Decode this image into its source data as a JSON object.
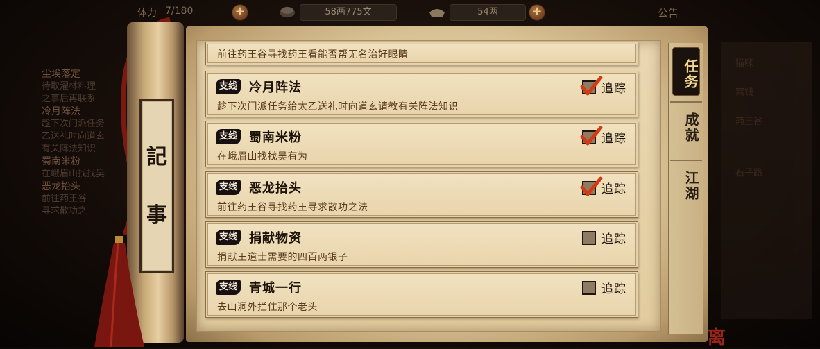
{
  "top_bar": {
    "stamina_label": "体力",
    "stamina_value": "7/180",
    "copper": "58两775文",
    "silver": "54两",
    "notice": "公告"
  },
  "background_list": [
    {
      "title": "尘埃落定",
      "lines": [
        "待取濯林料理",
        "之事后再联系"
      ]
    },
    {
      "title": "冷月阵法",
      "lines": [
        "趁下次门派任务",
        "乙送礼时向道玄",
        "有关阵法知识"
      ]
    },
    {
      "title": "蜀南米粉",
      "lines": [
        "在峨眉山找找吴"
      ]
    },
    {
      "title": "恶龙抬头",
      "lines": [
        "前往药王谷",
        "寻求散功之"
      ]
    }
  ],
  "background_right": [
    "猫咪",
    "寓钱",
    "药王谷",
    "石子路"
  ],
  "scroll_title": [
    "記",
    "事"
  ],
  "quests": [
    {
      "tag": "支线",
      "title": "",
      "desc": "前往药王谷寻找药王看能否帮无名治好眼睛",
      "tracked": null,
      "track_label": "",
      "partial": true
    },
    {
      "tag": "支线",
      "title": "冷月阵法",
      "desc": "趁下次门派任务给太乙送礼时向道玄请教有关阵法知识",
      "tracked": true,
      "track_label": "追踪"
    },
    {
      "tag": "支线",
      "title": "蜀南米粉",
      "desc": "在峨眉山找找吴有为",
      "tracked": true,
      "track_label": "追踪"
    },
    {
      "tag": "支线",
      "title": "恶龙抬头",
      "desc": "前往药王谷寻找药王寻求散功之法",
      "tracked": true,
      "track_label": "追踪"
    },
    {
      "tag": "支线",
      "title": "捐献物资",
      "desc": "捐献王道士需要的四百两银子",
      "tracked": false,
      "track_label": "追踪"
    },
    {
      "tag": "支线",
      "title": "青城一行",
      "desc": "去山洞外拦住那个老头",
      "tracked": false,
      "track_label": "追踪"
    }
  ],
  "tabs": [
    {
      "label": "任务",
      "active": true
    },
    {
      "label": "成就",
      "active": false
    },
    {
      "label": "江湖",
      "active": false
    }
  ],
  "colors": {
    "accent_gold": "#f2d690",
    "check_red": "#d23a12",
    "paper": "#e8d4ab"
  }
}
